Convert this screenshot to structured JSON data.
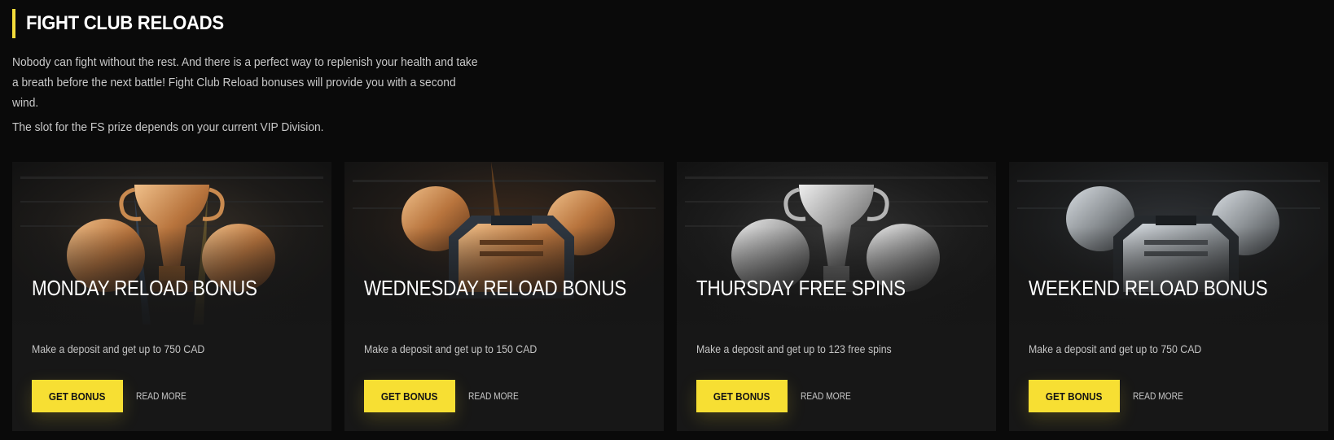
{
  "section": {
    "title": "FIGHT CLUB RELOADS",
    "intro": "Nobody can fight without the rest. And there is a perfect way to replenish your health and take a breath before the next battle! Fight Club Reload bonuses will provide you with a second wind.",
    "vip_note": "The slot for the FS prize depends on your current VIP Division."
  },
  "cards": [
    {
      "title": "MONDAY RELOAD BONUS",
      "description": "Make a deposit and get up to 750 CAD",
      "button_label": "GET BONUS",
      "link_label": "READ MORE",
      "art": "bronze-trophy-gloves",
      "tone": "#b8743d"
    },
    {
      "title": "WEDNESDAY RELOAD BONUS",
      "description": "Make a deposit and get up to 150 CAD",
      "button_label": "GET BONUS",
      "link_label": "READ MORE",
      "art": "bronze-chest-gloves",
      "tone": "#b8743d"
    },
    {
      "title": "THURSDAY FREE SPINS",
      "description": "Make a deposit and get up to 123 free spins",
      "button_label": "GET BONUS",
      "link_label": "READ MORE",
      "art": "silver-trophy-gloves",
      "tone": "#9a9a9a"
    },
    {
      "title": "WEEKEND RELOAD BONUS",
      "description": "Make a deposit and get up to 750 CAD",
      "button_label": "GET BONUS",
      "link_label": "READ MORE",
      "art": "silver-chest-gloves",
      "tone": "#8d9296"
    }
  ],
  "colors": {
    "accent": "#f7df33",
    "background": "#0a0a0a",
    "card": "#171717"
  }
}
